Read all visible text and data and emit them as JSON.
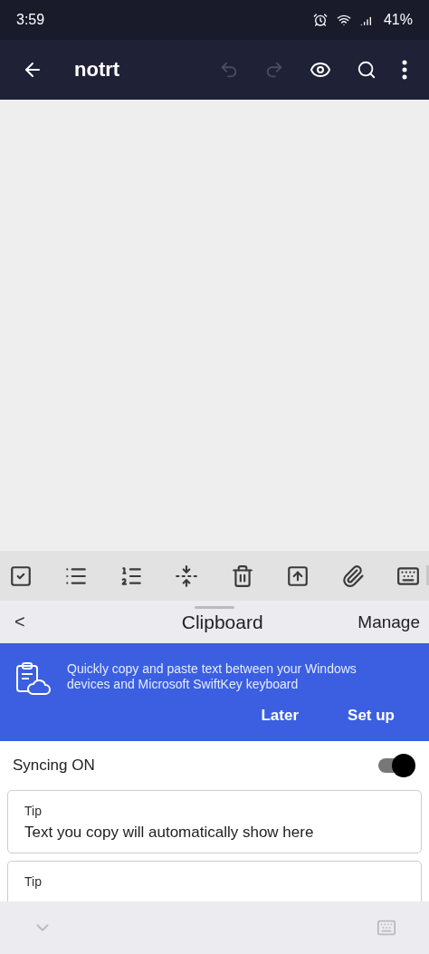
{
  "status_bar": {
    "time": "3:59",
    "battery": "41%"
  },
  "app_bar": {
    "title": "notrt",
    "undo_disabled": true,
    "redo_disabled": true
  },
  "editor_toolbar": {
    "scrollable": true
  },
  "clipboard": {
    "back": "<",
    "title": "Clipboard",
    "manage": "Manage",
    "banner": {
      "message": "Quickly copy and paste text between your Windows devices and Microsoft SwiftKey keyboard",
      "actions": [
        "Later",
        "Set up"
      ]
    },
    "syncing": {
      "label": "Syncing ON",
      "on": true
    },
    "tips": [
      {
        "label": "Tip",
        "text": "Text you copy will automatically show here"
      },
      {
        "label": "Tip"
      }
    ]
  }
}
